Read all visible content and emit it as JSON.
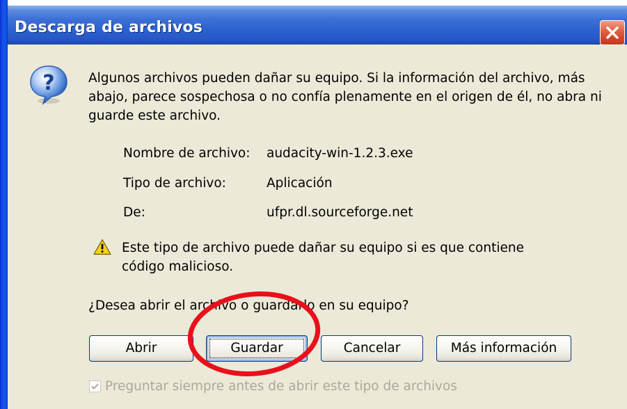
{
  "window": {
    "title": "Descarga de archivos"
  },
  "dialog": {
    "message": "Algunos archivos pueden dañar su equipo. Si la información del archivo, más abajo, parece sospechosa o no confía plenamente en el origen de él, no abra ni guarde este archivo.",
    "file_name_label": "Nombre de archivo:",
    "file_name_value": "audacity-win-1.2.3.exe",
    "file_type_label": "Tipo de archivo:",
    "file_type_value": "Aplicación",
    "from_label": "De:",
    "from_value": "ufpr.dl.sourceforge.net",
    "warning": "Este tipo de archivo puede dañar su equipo si es que contiene código malicioso.",
    "question": "¿Desea abrir el archivo o guardarlo en su equipo?"
  },
  "buttons": {
    "open": "Abrir",
    "save": "Guardar",
    "cancel": "Cancelar",
    "more_info": "Más información"
  },
  "checkbox": {
    "label": "Preguntar siempre antes de abrir este tipo de archivos",
    "checked": true,
    "disabled": true
  },
  "icons": {
    "dialog": "question-icon",
    "warning": "warning-icon",
    "close": "close-icon"
  },
  "colors": {
    "titlebar": "#2d63d1",
    "dialog_bg": "#ece9d8",
    "close_button": "#d34a2a",
    "highlight_ellipse": "#e8101a",
    "disabled_text": "#aca899"
  }
}
